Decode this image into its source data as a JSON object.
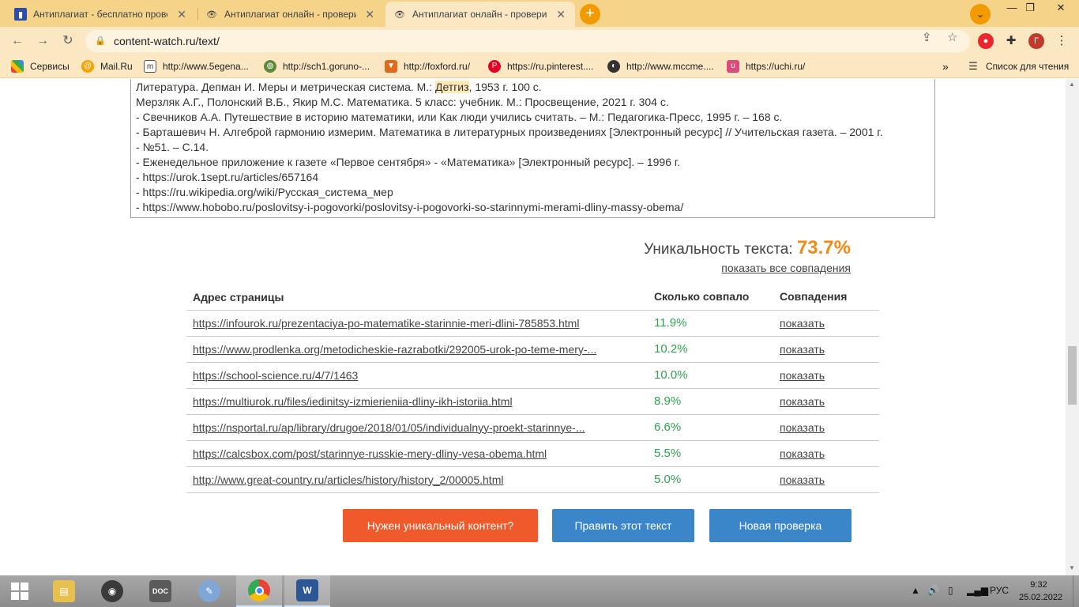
{
  "browser": {
    "tabs": [
      {
        "title": "Антиплагиат - бесплатно прове"
      },
      {
        "title": "Антиплагиат онлайн - провери"
      },
      {
        "title": "Антиплагиат онлайн - провери"
      }
    ],
    "url": "content-watch.ru/text/",
    "profile_letter": "Г",
    "bookmarks": [
      {
        "label": "Сервисы"
      },
      {
        "label": "Mail.Ru"
      },
      {
        "label": "http://www.5egena..."
      },
      {
        "label": "http://sch1.goruno-..."
      },
      {
        "label": "http://foxford.ru/"
      },
      {
        "label": "https://ru.pinterest...."
      },
      {
        "label": "http://www.mccme...."
      },
      {
        "label": "https://uchi.ru/"
      }
    ],
    "reading_list": "Список для чтения"
  },
  "textbox": {
    "lines": [
      "Литература. Депман И. Меры и метрическая система. М.: ",
      "Мерзляк А.Г., Полонский В.Б., Якир М.С. Математика. 5 класс: учебник. М.: Просвещение, 2021 г. 304 с.",
      "- Свечников А.А. Путешествие в историю математики, или Как люди учились считать. – М.: Педагогика-Пресс, 1995 г. – 168 с.",
      "- Барташевич Н. Алгеброй гармонию измерим. Математика в литературных произведениях [Электронный ресурс] // Учительская газета. – 2001 г.",
      "- №51. – С.14.",
      "- Еженедельное приложение к газете «Первое сентября» - «Математика» [Электронный ресурс]. – 1996 г.",
      "- https://urok.1sept.ru/articles/657164",
      "- https://ru.wikipedia.org/wiki/Русская_система_мер",
      "- https://www.hobobo.ru/poslovitsy-i-pogovorki/poslovitsy-i-pogovorki-so-starinnymi-merami-dliny-massy-obema/"
    ],
    "highlight": "Детгиз",
    "line0_tail": ", 1953 г. 100 с."
  },
  "result": {
    "uniqueness_label": "Уникальность текста: ",
    "uniqueness_value": "73.7%",
    "show_all": "показать все совпадения",
    "columns": [
      "Адрес страницы",
      "Сколько совпало",
      "Совпадения"
    ],
    "rows": [
      {
        "url": "https://infourok.ru/prezentaciya-po-matematike-starinnie-meri-dlini-785853.html",
        "percent": "11.9%",
        "action": "показать"
      },
      {
        "url": "https://www.prodlenka.org/metodicheskie-razrabotki/292005-urok-po-teme-mery-...",
        "percent": "10.2%",
        "action": "показать"
      },
      {
        "url": "https://school-science.ru/4/7/1463",
        "percent": "10.0%",
        "action": "показать"
      },
      {
        "url": "https://multiurok.ru/files/iedinitsy-izmierieniia-dliny-ikh-istoriia.html",
        "percent": "8.9%",
        "action": "показать"
      },
      {
        "url": "https://nsportal.ru/ap/library/drugoe/2018/01/05/individualnyy-proekt-starinnye-...",
        "percent": "6.6%",
        "action": "показать"
      },
      {
        "url": "https://calcsbox.com/post/starinnye-russkie-mery-dliny-vesa-obema.html",
        "percent": "5.5%",
        "action": "показать"
      },
      {
        "url": "http://www.great-country.ru/articles/history/history_2/00005.html",
        "percent": "5.0%",
        "action": "показать"
      }
    ],
    "buttons": {
      "need_content": "Нужен уникальный контент?",
      "edit_text": "Править этот текст",
      "new_check": "Новая проверка"
    }
  },
  "taskbar": {
    "lang": "РУС",
    "time": "9:32",
    "date": "25.02.2022"
  },
  "colors": {
    "tabstrip": "#f5d48a",
    "toolbar": "#fce7c3",
    "uniqueness": "#f28a13",
    "match_percent": "#2ea44f",
    "button_orange": "#f05a2a",
    "button_blue": "#3a86c8"
  }
}
